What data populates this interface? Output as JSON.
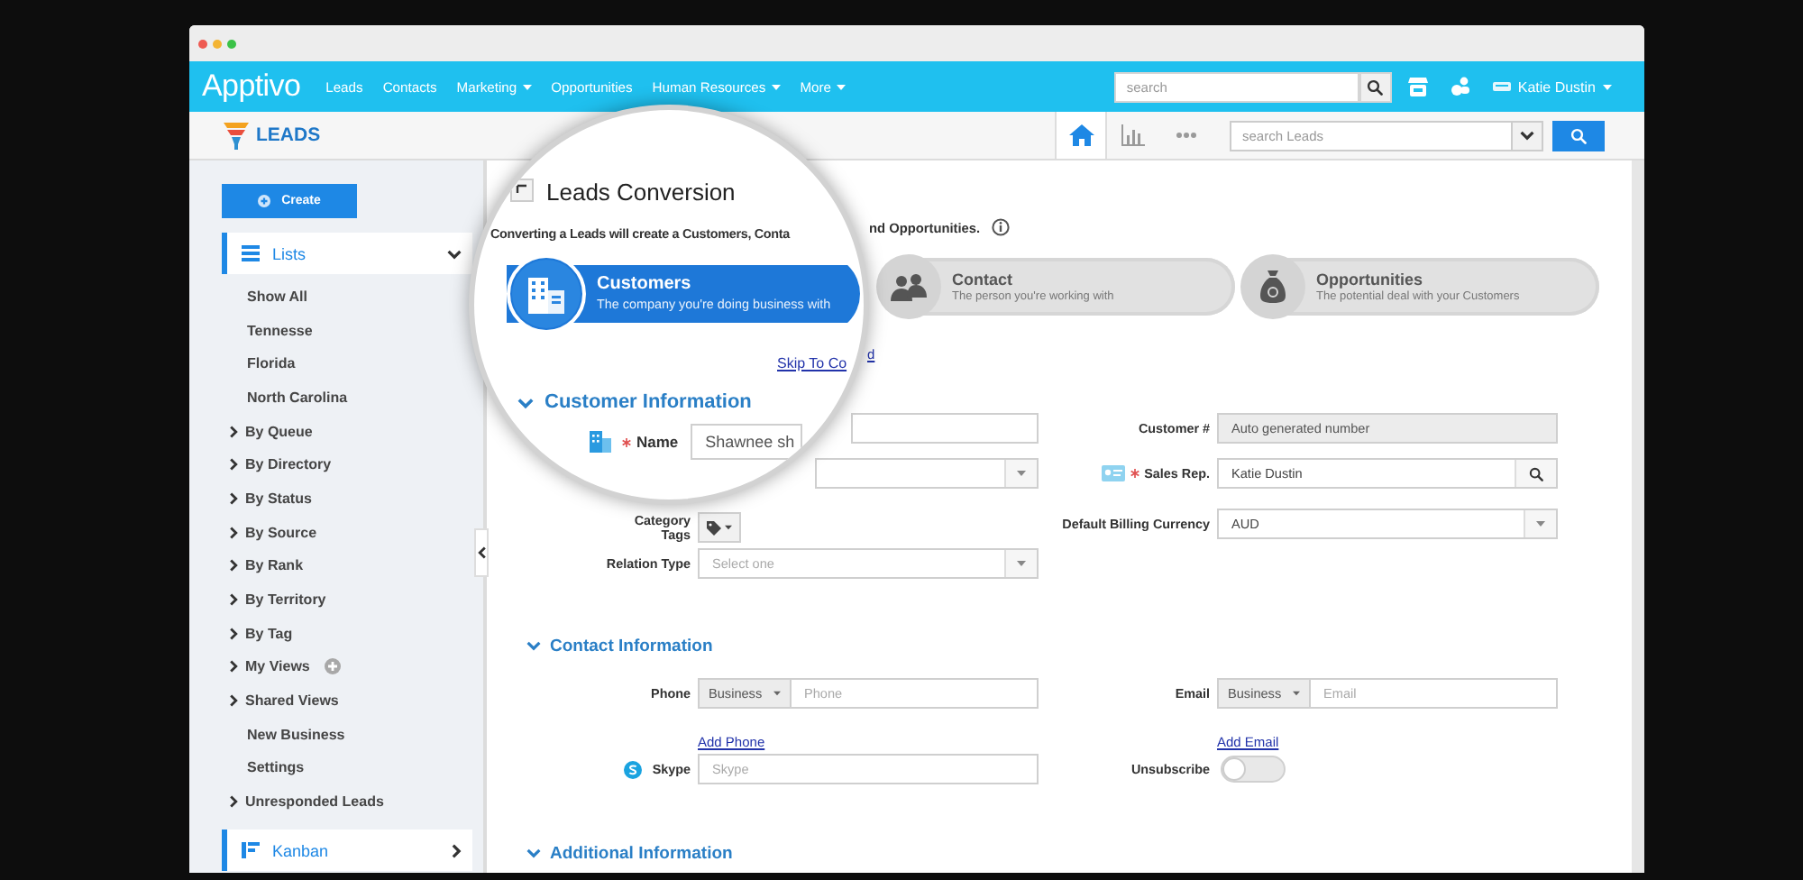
{
  "nav": {
    "logo": "Apptivo",
    "links": [
      {
        "label": "Leads",
        "dropdown": false
      },
      {
        "label": "Contacts",
        "dropdown": false
      },
      {
        "label": "Marketing",
        "dropdown": true
      },
      {
        "label": "Opportunities",
        "dropdown": false
      },
      {
        "label": "Human Resources",
        "dropdown": true
      },
      {
        "label": "More",
        "dropdown": true
      }
    ],
    "search": {
      "placeholder": "search"
    },
    "user": "Katie Dustin"
  },
  "app_bar": {
    "title": "LEADS",
    "views": [
      {
        "kind": "home",
        "selected": true
      },
      {
        "kind": "chart",
        "selected": false
      },
      {
        "kind": "more",
        "selected": false
      }
    ],
    "search": {
      "placeholder": "search Leads"
    }
  },
  "sidebar": {
    "create": "Create",
    "sections": [
      {
        "label": "Lists",
        "kind": "list",
        "expanded": true,
        "items": [
          {
            "label": "Show All",
            "kind": "link"
          },
          {
            "label": "Tennesse",
            "kind": "link"
          },
          {
            "label": "Florida",
            "kind": "link"
          },
          {
            "label": "North Carolina",
            "kind": "link"
          },
          {
            "label": "By Queue",
            "kind": "group"
          },
          {
            "label": "By Directory",
            "kind": "group"
          },
          {
            "label": "By Status",
            "kind": "group"
          },
          {
            "label": "By Source",
            "kind": "group"
          },
          {
            "label": "By Rank",
            "kind": "group"
          },
          {
            "label": "By Territory",
            "kind": "group"
          },
          {
            "label": "By Tag",
            "kind": "group"
          },
          {
            "label": "My Views",
            "kind": "group_add"
          },
          {
            "label": "Shared Views",
            "kind": "group"
          },
          {
            "label": "New Business",
            "kind": "link"
          },
          {
            "label": "Settings",
            "kind": "link"
          },
          {
            "label": "Unresponded Leads",
            "kind": "group"
          }
        ]
      },
      {
        "label": "Kanban",
        "kind": "kanban",
        "expanded": false
      }
    ]
  },
  "conversion": {
    "title": "Leads Conversion",
    "intro_start": "Converting a Leads will create a Customers, Conta",
    "intro_end": "nd Opportunities.",
    "steps": [
      {
        "kind": "customer",
        "title": "Customers",
        "subtitle": "The company you're doing business with",
        "selected": true
      },
      {
        "kind": "contact",
        "title": "Contact",
        "subtitle": "The person you're working with",
        "selected": false
      },
      {
        "kind": "opportunity",
        "title": "Opportunities",
        "subtitle": "The potential deal with your Customers",
        "selected": false
      }
    ],
    "skip_link": "Skip To Co",
    "cut_link": "d"
  },
  "customer_information": {
    "title": "Customer Information",
    "expanded": true,
    "name": {
      "label": "Name",
      "required": true,
      "value": "Shawnee sh"
    },
    "category_label": "Category",
    "tags_label": "Tags",
    "relation_type": {
      "label": "Relation Type",
      "placeholder": "Select one"
    },
    "customer_number": {
      "label": "Customer #",
      "value": "Auto generated number",
      "disabled": true
    },
    "sales_rep": {
      "label": "Sales Rep.",
      "required": true,
      "value": "Katie Dustin"
    },
    "billing_currency": {
      "label": "Default Billing Currency",
      "value": "AUD"
    }
  },
  "contact_information": {
    "title": "Contact Information",
    "expanded": true,
    "phone": {
      "label": "Phone",
      "type": "Business",
      "placeholder": "Phone",
      "add_link": "Add Phone"
    },
    "email": {
      "label": "Email",
      "type": "Business",
      "placeholder": "Email",
      "add_link": "Add Email"
    },
    "skype": {
      "label": "Skype",
      "placeholder": "Skype"
    },
    "unsubscribe": {
      "label": "Unsubscribe",
      "on": false
    }
  },
  "additional_information": {
    "title": "Additional Information",
    "expanded": true
  }
}
